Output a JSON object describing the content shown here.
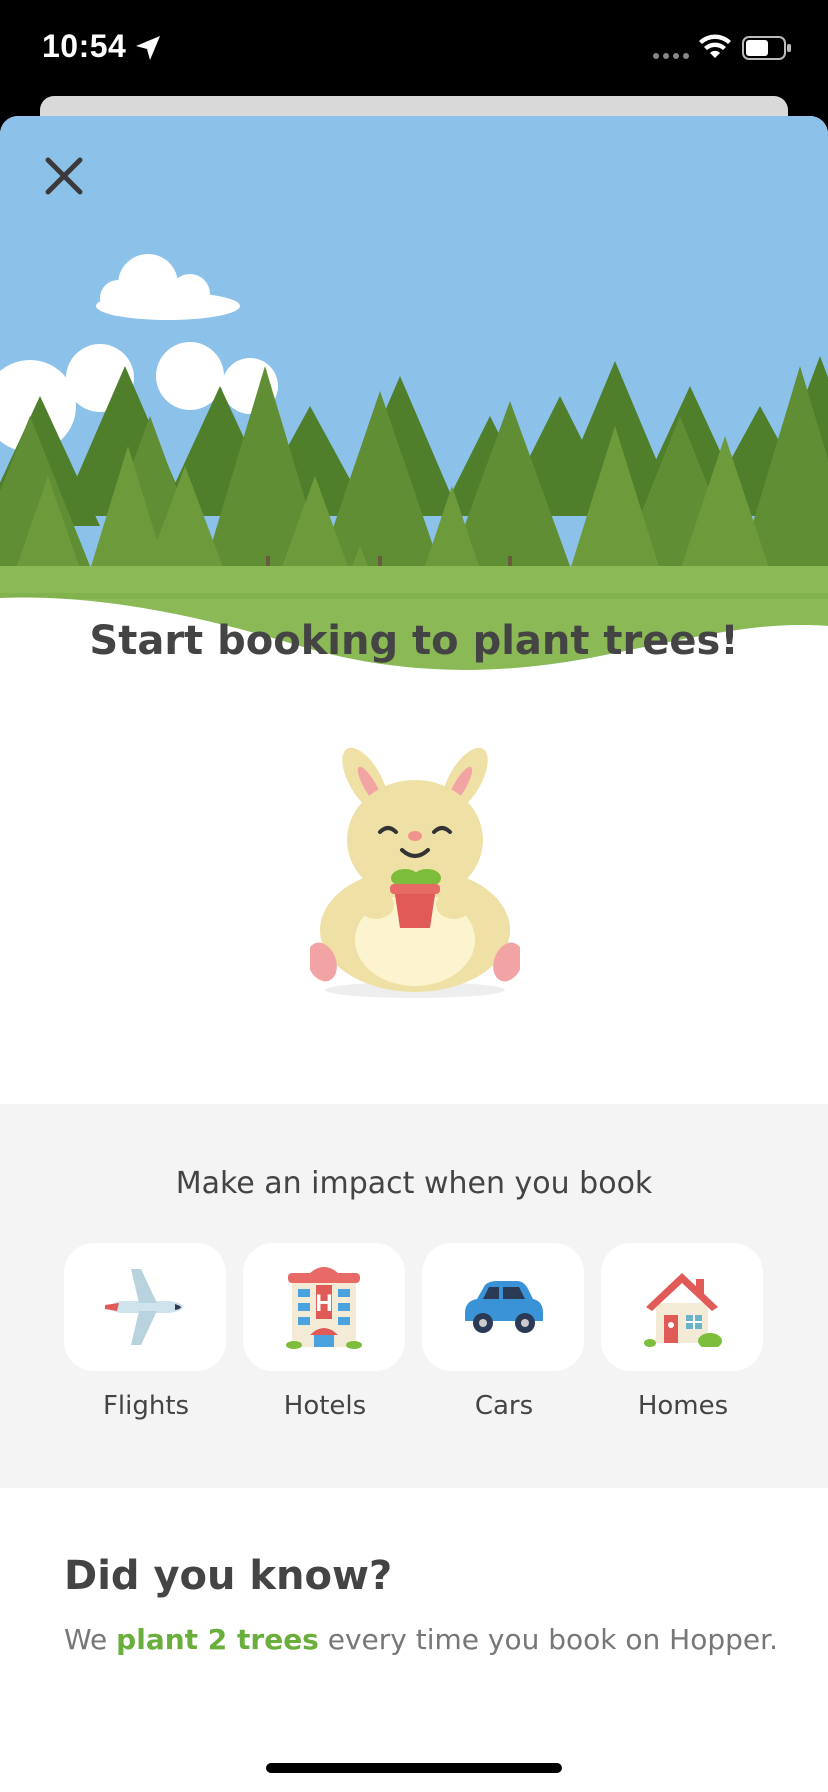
{
  "status_bar": {
    "time": "10:54"
  },
  "hero": {
    "close_icon": "close-icon"
  },
  "headline": "Start booking to plant trees!",
  "impact": {
    "title": "Make an impact when you book",
    "categories": [
      {
        "label": "Flights",
        "icon": "airplane-icon"
      },
      {
        "label": "Hotels",
        "icon": "hotel-icon"
      },
      {
        "label": "Cars",
        "icon": "car-icon"
      },
      {
        "label": "Homes",
        "icon": "house-icon"
      }
    ]
  },
  "info": {
    "title": "Did you know?",
    "fact_prefix": "We ",
    "fact_highlight": "plant 2 trees",
    "fact_suffix": " every time you book on Hopper."
  },
  "colors": {
    "sky": "#8cc1ea",
    "grass": "#8ab955",
    "highlight": "#6aae3c",
    "panel": "#f4f4f4"
  }
}
